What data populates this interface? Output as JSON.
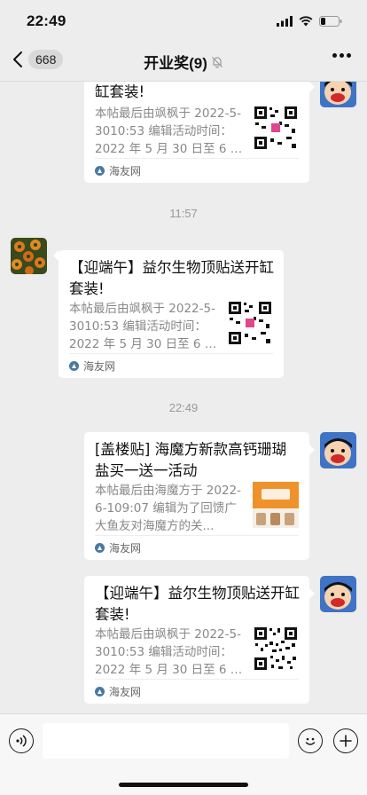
{
  "status": {
    "time": "22:49"
  },
  "nav": {
    "back_count": "668",
    "title": "开业奖(9)"
  },
  "timestamps": [
    "11:57",
    "22:49"
  ],
  "messages": [
    {
      "side": "right",
      "title": "【迎端午】益尔生物顶贴送开缸套装!",
      "title_visible": "缸套装!",
      "desc": "本帖最后由飒枫于 2022-5-3010:53 编辑活动时间：2022 年 5 月 30 日至 6 月 ...",
      "source": "海友网",
      "thumb": "qr-code"
    },
    {
      "side": "left",
      "title": "【迎端午】益尔生物顶贴送开缸套装!",
      "desc": "本帖最后由飒枫于 2022-5-3010:53 编辑活动时间：2022 年 5 月 30 日至 6 月 ...",
      "source": "海友网",
      "thumb": "qr-code"
    },
    {
      "side": "right",
      "title": "[盖楼贴] 海魔方新款高钙珊瑚盐买一送一活动",
      "desc": "本帖最后由海魔方于 2022-6-109:07 编辑为了回馈广大鱼友对海魔方的关...",
      "source": "海友网",
      "thumb": "product-image"
    },
    {
      "side": "right",
      "title": "【迎端午】益尔生物顶贴送开缸套装!",
      "desc": "本帖最后由飒枫于 2022-5-3010:53 编辑活动时间：2022 年 5 月 30 日至 6 月 ...",
      "source": "海友网",
      "thumb": "qr-code"
    }
  ],
  "thumb_colors": {
    "qr_accent": "#e0468c",
    "product_orange": "#f0922b"
  }
}
